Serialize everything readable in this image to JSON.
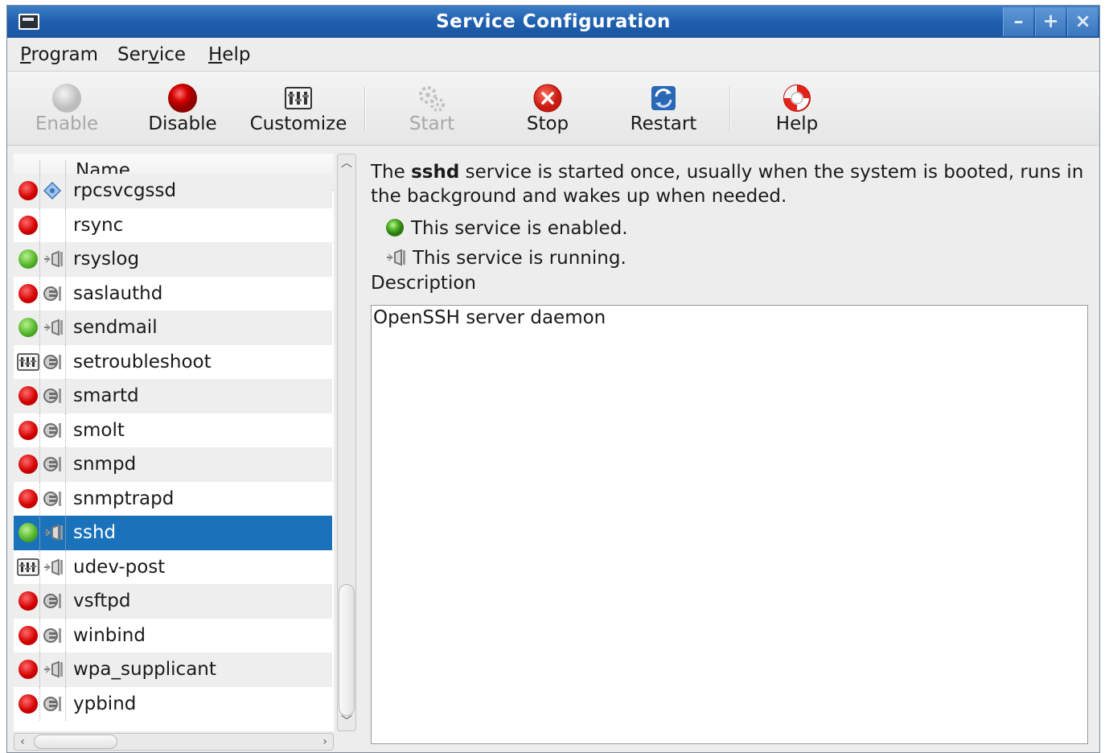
{
  "window": {
    "title": "Service Configuration",
    "controls": {
      "minimize": "–",
      "maximize": "+",
      "close": "×"
    }
  },
  "menu": {
    "items": [
      {
        "mnemonic": "P",
        "rest": "rogram"
      },
      {
        "pre": "Ser",
        "mnemonic": "v",
        "rest": "ice"
      },
      {
        "mnemonic": "H",
        "rest": "elp"
      }
    ]
  },
  "toolbar": {
    "enable": "Enable",
    "disable": "Disable",
    "customize": "Customize",
    "start": "Start",
    "stop": "Stop",
    "restart": "Restart",
    "help": "Help"
  },
  "list": {
    "column_name": "Name",
    "rows": [
      {
        "name": "rpcsvcgssd",
        "status": "red",
        "run": "diamond"
      },
      {
        "name": "rsync",
        "status": "red",
        "run": "none"
      },
      {
        "name": "rsyslog",
        "status": "green",
        "run": "plug-running"
      },
      {
        "name": "saslauthd",
        "status": "red",
        "run": "plug-stopped"
      },
      {
        "name": "sendmail",
        "status": "green",
        "run": "plug-running"
      },
      {
        "name": "setroubleshoot",
        "status": "custom",
        "run": "plug-stopped"
      },
      {
        "name": "smartd",
        "status": "red",
        "run": "plug-stopped"
      },
      {
        "name": "smolt",
        "status": "red",
        "run": "plug-stopped"
      },
      {
        "name": "snmpd",
        "status": "red",
        "run": "plug-stopped"
      },
      {
        "name": "snmptrapd",
        "status": "red",
        "run": "plug-stopped"
      },
      {
        "name": "sshd",
        "status": "green",
        "run": "plug-running",
        "selected": true
      },
      {
        "name": "udev-post",
        "status": "custom",
        "run": "plug-running"
      },
      {
        "name": "vsftpd",
        "status": "red",
        "run": "plug-stopped"
      },
      {
        "name": "winbind",
        "status": "red",
        "run": "plug-stopped"
      },
      {
        "name": "wpa_supplicant",
        "status": "red",
        "run": "plug-running"
      },
      {
        "name": "ypbind",
        "status": "red",
        "run": "plug-stopped"
      }
    ]
  },
  "detail": {
    "summary_prefix": "The ",
    "service_name": "sshd",
    "summary_suffix": " service is started once, usually when the system is booted, runs in the background and wakes up when needed.",
    "enabled_text": "This service is enabled.",
    "running_text": "This service is running.",
    "description_label": "Description",
    "description_text": "OpenSSH server daemon"
  },
  "colors": {
    "titlebar": "#1f5fae",
    "selection": "#1a72bb",
    "enabled_green": "#53b52a",
    "disabled_red": "#d40000"
  }
}
